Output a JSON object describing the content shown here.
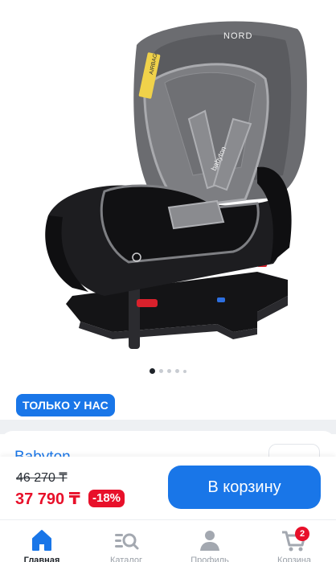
{
  "product": {
    "image_brand_label": "NORD",
    "image_side_label": "babyton",
    "image_airbag_label": "AIRBAG",
    "gallery_dot_count": 5,
    "gallery_active_index": 0,
    "badge": "ТОЛЬКО У НАС",
    "brand": "Babyton"
  },
  "purchase": {
    "old_price": "46 270 ₸",
    "new_price": "37 790 ₸",
    "discount": "-18%",
    "cart_button_label": "В корзину"
  },
  "tab_bar": {
    "items": [
      {
        "label": "Главная",
        "icon": "home-icon",
        "active": true
      },
      {
        "label": "Каталог",
        "icon": "catalog-search-icon",
        "active": false
      },
      {
        "label": "Профиль",
        "icon": "profile-icon",
        "active": false
      },
      {
        "label": "Корзина",
        "icon": "cart-icon",
        "active": false,
        "badge": "2"
      }
    ]
  },
  "colors": {
    "accent": "#1976e8",
    "sale": "#e8102a"
  }
}
